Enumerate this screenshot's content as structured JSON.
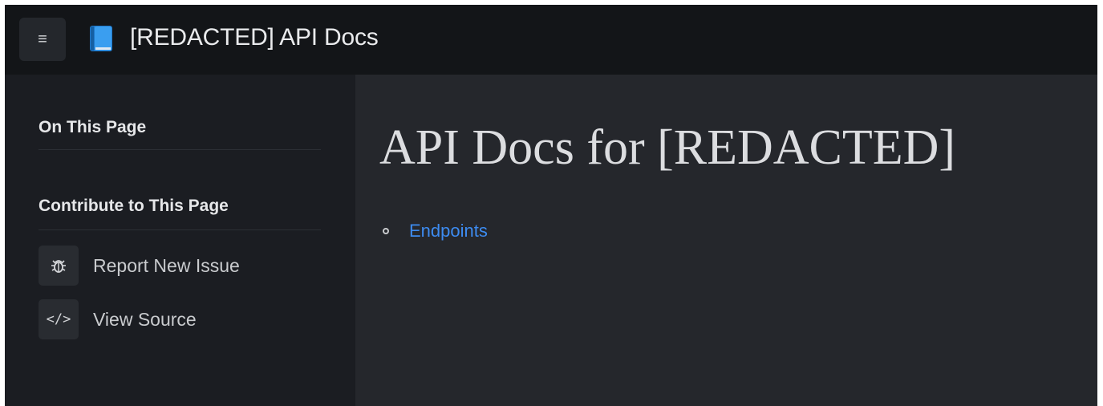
{
  "header": {
    "menu_icon": "hamburger-menu-icon",
    "logo_icon": "blue-book-icon",
    "title": "[REDACTED] API Docs"
  },
  "sidebar": {
    "on_this_page_heading": "On This Page",
    "contribute_heading": "Contribute to This Page",
    "items": [
      {
        "icon": "bug-icon",
        "label": "Report New Issue"
      },
      {
        "icon": "code-icon",
        "label": "View Source"
      }
    ]
  },
  "main": {
    "title": "API Docs for [REDACTED]",
    "toc": [
      {
        "label": "Endpoints"
      }
    ]
  },
  "colors": {
    "topbar": "#131518",
    "sidebar": "#1b1d22",
    "content": "#25272c",
    "link": "#3d8bf0",
    "book": "#2a8ce3"
  }
}
